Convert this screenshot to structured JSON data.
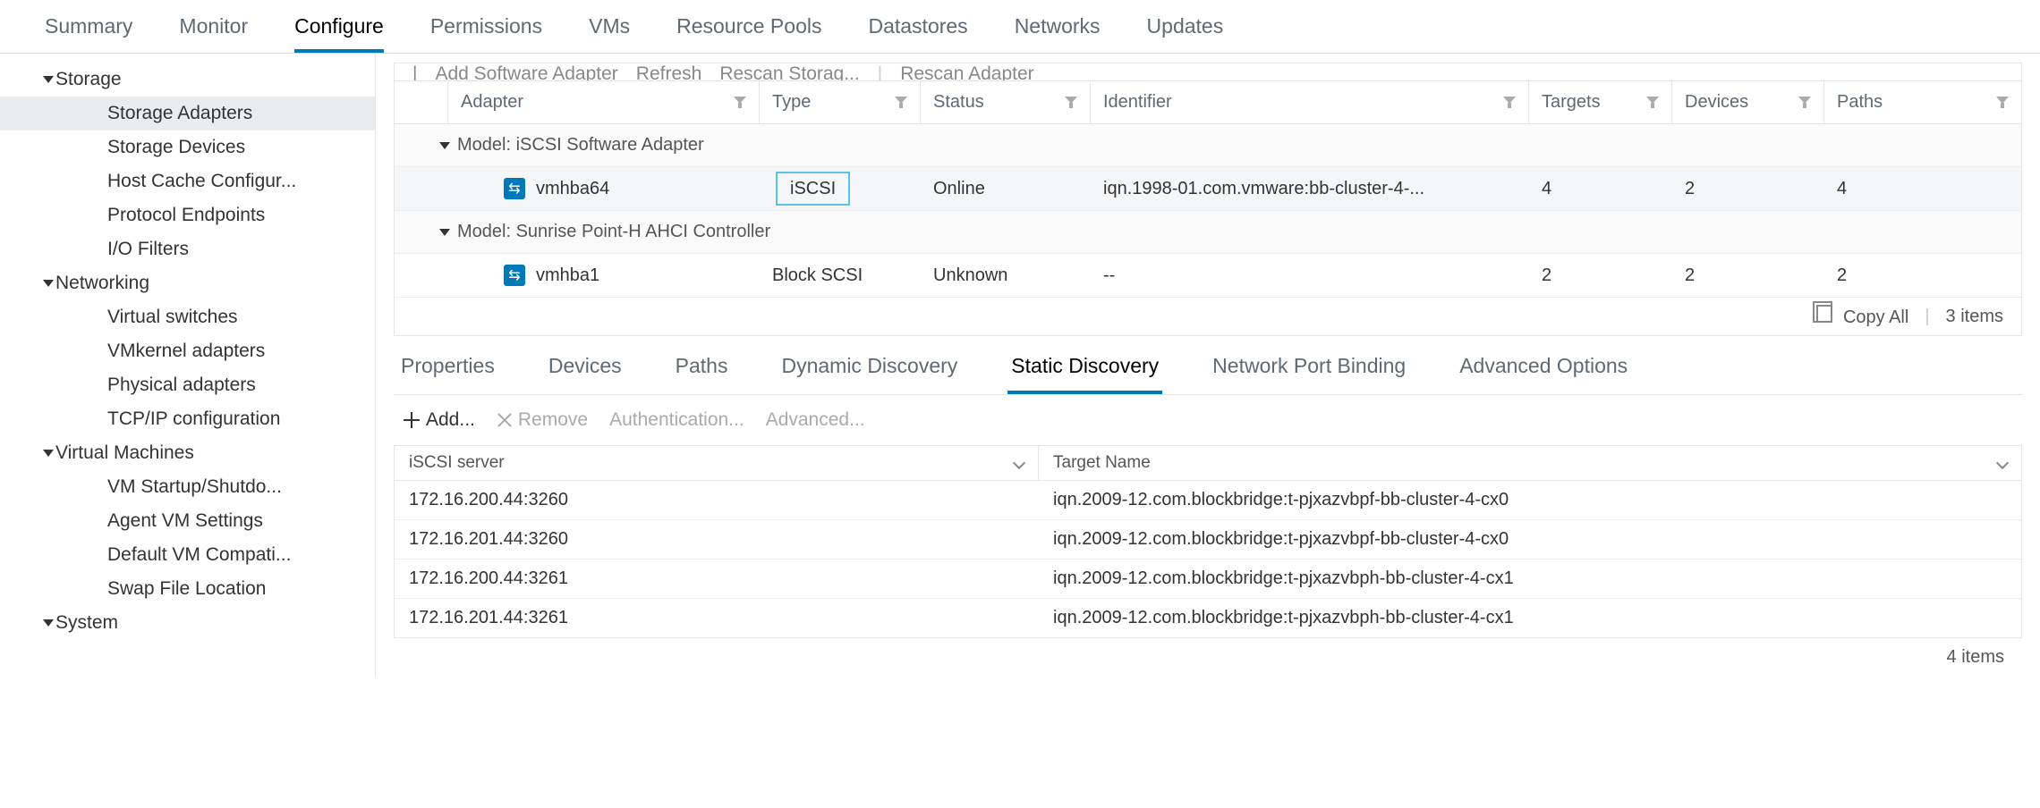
{
  "top_tabs": {
    "summary": "Summary",
    "monitor": "Monitor",
    "configure": "Configure",
    "permissions": "Permissions",
    "vms": "VMs",
    "resource_pools": "Resource Pools",
    "datastores": "Datastores",
    "networks": "Networks",
    "updates": "Updates"
  },
  "sidebar": {
    "storage": {
      "label": "Storage",
      "items": {
        "storage_adapters": "Storage Adapters",
        "storage_devices": "Storage Devices",
        "host_cache": "Host Cache Configur...",
        "protocol_endpoints": "Protocol Endpoints",
        "io_filters": "I/O Filters"
      }
    },
    "networking": {
      "label": "Networking",
      "items": {
        "virtual_switches": "Virtual switches",
        "vmkernel_adapters": "VMkernel adapters",
        "physical_adapters": "Physical adapters",
        "tcpip": "TCP/IP configuration"
      }
    },
    "virtual_machines": {
      "label": "Virtual Machines",
      "items": {
        "vm_startup": "VM Startup/Shutdo...",
        "agent_vm": "Agent VM Settings",
        "default_compat": "Default VM Compati...",
        "swap_file": "Swap File Location"
      }
    },
    "system": {
      "label": "System"
    }
  },
  "adapter_toolbar": {
    "add_adapter": "Add Software Adapter",
    "refresh": "Refresh",
    "rescan_storage": "Rescan Storag...",
    "rescan_adapter": "Rescan Adapter"
  },
  "adapter_table": {
    "headers": {
      "adapter": "Adapter",
      "type": "Type",
      "status": "Status",
      "identifier": "Identifier",
      "targets": "Targets",
      "devices": "Devices",
      "paths": "Paths"
    },
    "group_iscsi": "Model: iSCSI Software Adapter",
    "group_ahci": "Model: Sunrise Point-H AHCI Controller",
    "rows": {
      "vmhba64": {
        "adapter": "vmhba64",
        "type": "iSCSI",
        "status": "Online",
        "identifier": "iqn.1998-01.com.vmware:bb-cluster-4-...",
        "targets": "4",
        "devices": "2",
        "paths": "4"
      },
      "vmhba1": {
        "adapter": "vmhba1",
        "type": "Block SCSI",
        "status": "Unknown",
        "identifier": "--",
        "targets": "2",
        "devices": "2",
        "paths": "2"
      }
    },
    "footer": {
      "copy_all": "Copy All",
      "items": "3 items"
    }
  },
  "sub_tabs": {
    "properties": "Properties",
    "devices": "Devices",
    "paths": "Paths",
    "dynamic": "Dynamic Discovery",
    "static": "Static Discovery",
    "port_binding": "Network Port Binding",
    "advanced": "Advanced Options"
  },
  "disc_actions": {
    "add": "Add...",
    "remove": "Remove",
    "authentication": "Authentication...",
    "advanced": "Advanced..."
  },
  "disc_table": {
    "headers": {
      "server": "iSCSI server",
      "target": "Target Name"
    },
    "rows": [
      {
        "server": "172.16.200.44:3260",
        "target": "iqn.2009-12.com.blockbridge:t-pjxazvbpf-bb-cluster-4-cx0"
      },
      {
        "server": "172.16.201.44:3260",
        "target": "iqn.2009-12.com.blockbridge:t-pjxazvbpf-bb-cluster-4-cx0"
      },
      {
        "server": "172.16.200.44:3261",
        "target": "iqn.2009-12.com.blockbridge:t-pjxazvbph-bb-cluster-4-cx1"
      },
      {
        "server": "172.16.201.44:3261",
        "target": "iqn.2009-12.com.blockbridge:t-pjxazvbph-bb-cluster-4-cx1"
      }
    ],
    "footer": "4 items"
  }
}
